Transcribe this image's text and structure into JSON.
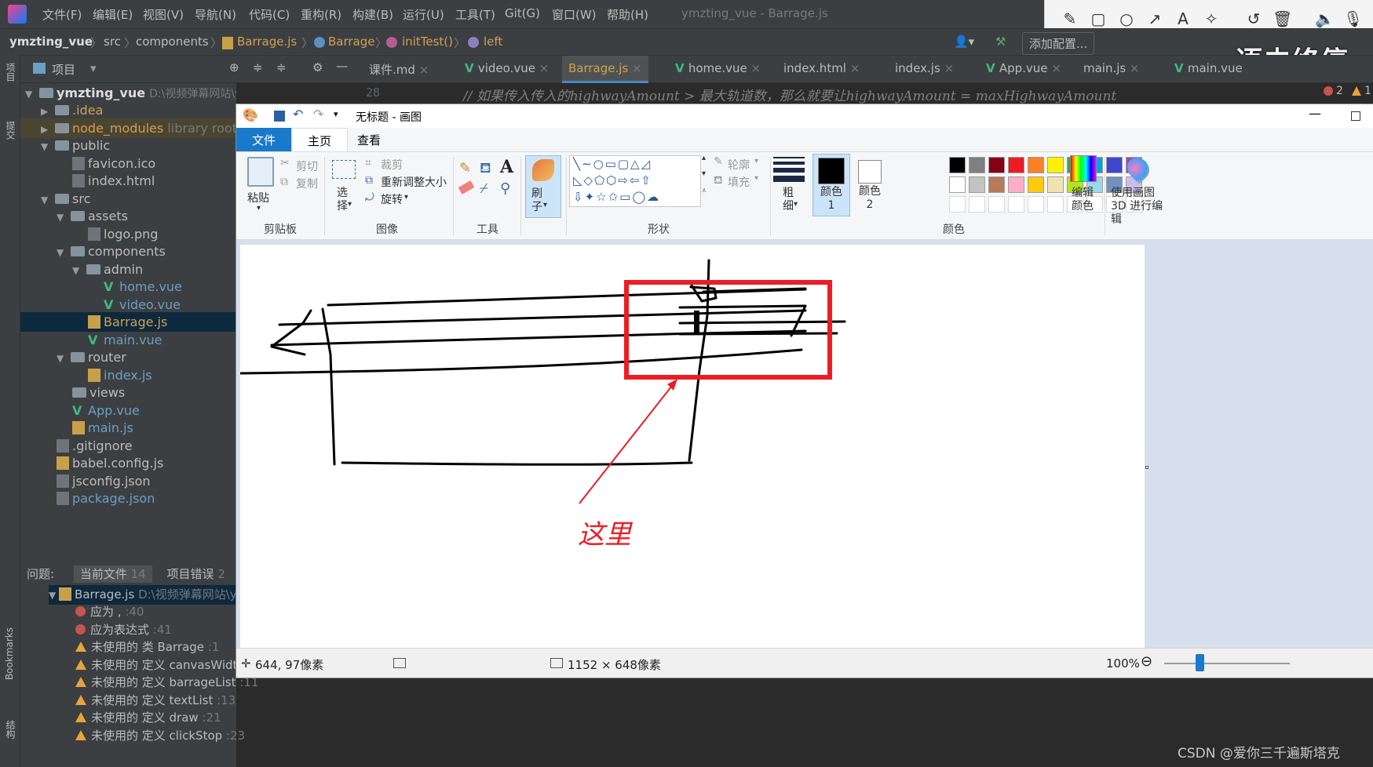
{
  "ide": {
    "menu": [
      "文件(F)",
      "编辑(E)",
      "视图(V)",
      "导航(N)",
      "代码(C)",
      "重构(R)",
      "构建(B)",
      "运行(U)",
      "工具(T)",
      "Git(G)",
      "窗口(W)",
      "帮助(H)"
    ],
    "window_title": "ymzting_vue - Barrage.js",
    "breadcrumb": [
      "ymzting_vue",
      "src",
      "components",
      "Barrage.js",
      "Barrage",
      "initTest()",
      "left"
    ],
    "add_config": "添加配置...",
    "project_label": "项目",
    "tabs": [
      "课件.md",
      "video.vue",
      "Barrage.js",
      "home.vue",
      "index.html",
      "index.js",
      "App.vue",
      "main.js",
      "main.vue"
    ],
    "active_tab": "Barrage.js",
    "line_number": "28",
    "code_comment": "// 如果传入传入的highwayAmount > 最大轨道数，那么就要让highwayAmount = maxHighwayAmount",
    "error_count": "2",
    "warn_count": "1",
    "tree": [
      {
        "label": "ymzting_vue",
        "path": "D:\\视频弹幕网站\\ymzting_vue",
        "depth": 0,
        "type": "root"
      },
      {
        "label": ".idea",
        "depth": 1,
        "type": "folder"
      },
      {
        "label": "node_modules",
        "extra": "library root",
        "depth": 1,
        "type": "folder"
      },
      {
        "label": "public",
        "depth": 1,
        "type": "folder"
      },
      {
        "label": "favicon.ico",
        "depth": 2,
        "type": "file"
      },
      {
        "label": "index.html",
        "depth": 2,
        "type": "file"
      },
      {
        "label": "src",
        "depth": 1,
        "type": "folder"
      },
      {
        "label": "assets",
        "depth": 2,
        "type": "folder"
      },
      {
        "label": "logo.png",
        "depth": 3,
        "type": "file"
      },
      {
        "label": "components",
        "depth": 2,
        "type": "folder"
      },
      {
        "label": "admin",
        "depth": 3,
        "type": "folder"
      },
      {
        "label": "home.vue",
        "depth": 4,
        "type": "vue"
      },
      {
        "label": "video.vue",
        "depth": 4,
        "type": "vue"
      },
      {
        "label": "Barrage.js",
        "depth": 3,
        "type": "js"
      },
      {
        "label": "main.vue",
        "depth": 3,
        "type": "vue"
      },
      {
        "label": "router",
        "depth": 2,
        "type": "folder"
      },
      {
        "label": "index.js",
        "depth": 3,
        "type": "js"
      },
      {
        "label": "views",
        "depth": 2,
        "type": "folder"
      },
      {
        "label": "App.vue",
        "depth": 2,
        "type": "vue"
      },
      {
        "label": "main.js",
        "depth": 2,
        "type": "js"
      },
      {
        "label": ".gitignore",
        "depth": 1,
        "type": "file"
      },
      {
        "label": "babel.config.js",
        "depth": 1,
        "type": "js"
      },
      {
        "label": "jsconfig.json",
        "depth": 1,
        "type": "file"
      },
      {
        "label": "package.json",
        "depth": 1,
        "type": "file"
      }
    ],
    "problems": {
      "title": "问题:",
      "tab_current": "当前文件",
      "tab_current_count": "14",
      "tab_project": "项目错误",
      "tab_project_count": "2",
      "file": "Barrage.js",
      "file_path": "D:\\视频弹幕网站\\y",
      "items": [
        {
          "kind": "error",
          "text": "应为 ,",
          "line": ":40"
        },
        {
          "kind": "error",
          "text": "应为表达式",
          "line": ":41"
        },
        {
          "kind": "warn",
          "text": "未使用的 类 Barrage",
          "line": ":1"
        },
        {
          "kind": "warn",
          "text": "未使用的 定义 canvasWidth",
          "line": ""
        },
        {
          "kind": "warn",
          "text": "未使用的 定义 barrageList",
          "line": ":11"
        },
        {
          "kind": "warn",
          "text": "未使用的 定义 textList",
          "line": ":13"
        },
        {
          "kind": "warn",
          "text": "未使用的 定义 draw",
          "line": ":21"
        },
        {
          "kind": "warn",
          "text": "未使用的 定义 clickStop",
          "line": ":23"
        }
      ]
    },
    "side_labels": {
      "project": "项目",
      "commit": "提交",
      "bookmarks": "Bookmarks",
      "structure": "结构"
    }
  },
  "overlay_text": "语未终停",
  "paint": {
    "title": "无标题 - 画图",
    "ribbon_tabs": [
      "文件",
      "主页",
      "查看"
    ],
    "clipboard": {
      "paste": "粘贴",
      "cut": "剪切",
      "copy": "复制",
      "group": "剪贴板"
    },
    "image": {
      "select": "选择",
      "crop": "裁剪",
      "resize": "重新调整大小",
      "rotate": "旋转",
      "group": "图像"
    },
    "tools": {
      "group": "工具"
    },
    "brush": "刷子",
    "shapes": {
      "outline": "轮廓",
      "fill": "填充",
      "group": "形状"
    },
    "size": "粗细",
    "color1": "颜色 1",
    "color2": "颜色 2",
    "edit_colors": "编辑颜色",
    "paint3d": "使用画图 3D 进行编辑",
    "colors_group": "颜色",
    "palette_row1": [
      "#000000",
      "#7f7f7f",
      "#880015",
      "#ed1c24",
      "#ff7f27",
      "#fff200",
      "#22b14c",
      "#00a2e8",
      "#3f48cc",
      "#a349a4"
    ],
    "palette_row2": [
      "#ffffff",
      "#c3c3c3",
      "#b97a57",
      "#ffaec9",
      "#ffc90e",
      "#efe4b0",
      "#b5e61d",
      "#99d9ea",
      "#7092be",
      "#c8bfe7"
    ],
    "annotation_label": "这里",
    "status": {
      "cursor": "644, 97像素",
      "size": "1152 × 648像素",
      "zoom": "100%"
    }
  },
  "watermark": "CSDN @爱你三千遍斯塔克"
}
